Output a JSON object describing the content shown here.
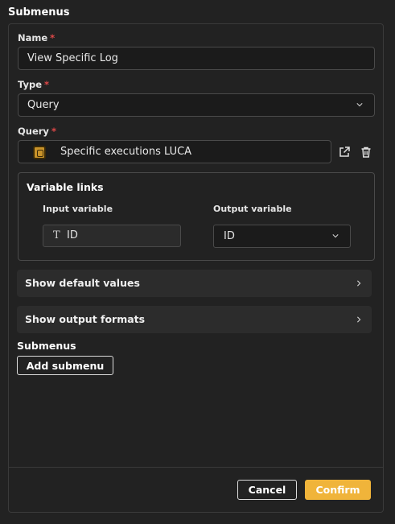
{
  "header": {
    "title": "Submenus"
  },
  "form": {
    "name": {
      "label": "Name",
      "required_mark": "*",
      "value": "View Specific Log"
    },
    "type": {
      "label": "Type",
      "required_mark": "*",
      "value": "Query"
    },
    "query": {
      "label": "Query",
      "required_mark": "*",
      "value": "Specific executions LUCA"
    }
  },
  "variable_links": {
    "title": "Variable links",
    "input_label": "Input variable",
    "output_label": "Output variable",
    "input_value": "ID",
    "output_value": "ID"
  },
  "accordions": [
    {
      "label": "Show default values"
    },
    {
      "label": "Show output formats"
    }
  ],
  "submenus": {
    "label": "Submenus",
    "add_button": "Add submenu"
  },
  "footer": {
    "cancel": "Cancel",
    "confirm": "Confirm"
  },
  "colors": {
    "accent": "#f0b43a",
    "required": "#e04848",
    "background": "#222222"
  },
  "icons": {
    "select": "chevron-down-icon",
    "external": "external-link-icon",
    "delete": "trash-icon",
    "accordion": "chevron-right-icon",
    "text_type": "text-type-icon",
    "query": "query-icon"
  }
}
